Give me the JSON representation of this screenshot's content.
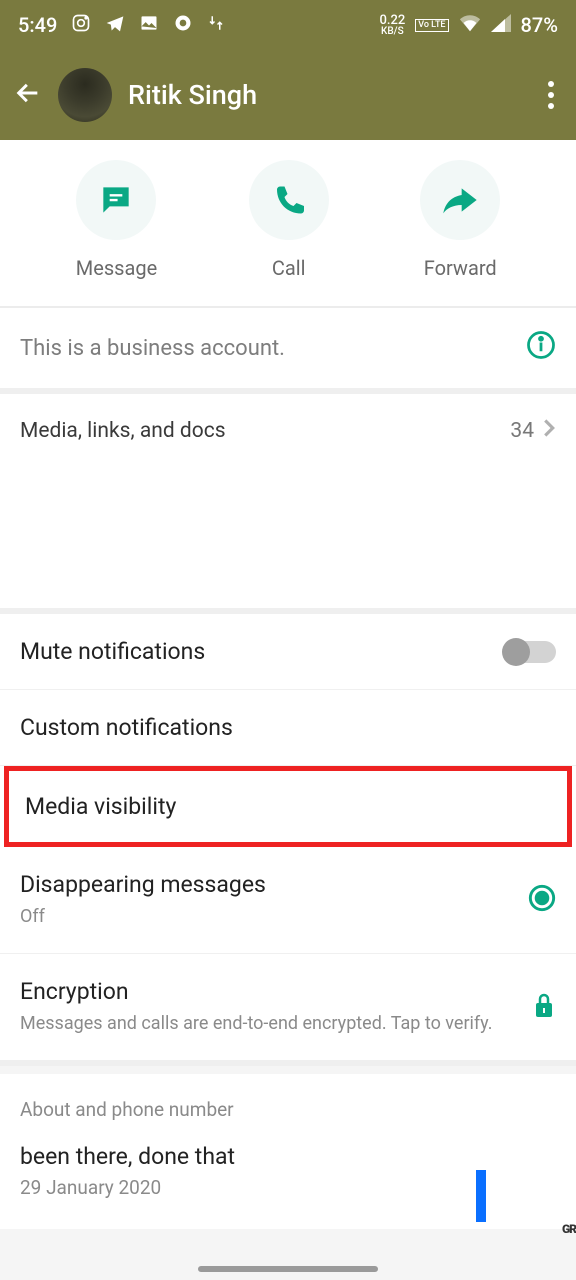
{
  "status": {
    "time": "5:49",
    "network_speed": "0.22",
    "network_unit": "KB/S",
    "lte_label": "Vo LTE",
    "battery": "87%"
  },
  "header": {
    "contact_name": "Ritik Singh"
  },
  "actions": {
    "message": "Message",
    "call": "Call",
    "forward": "Forward"
  },
  "business_banner": "This is a business account.",
  "media": {
    "label": "Media, links, and docs",
    "count": "34"
  },
  "settings": {
    "mute": "Mute notifications",
    "custom": "Custom notifications",
    "media_visibility": "Media visibility",
    "disappearing": "Disappearing messages",
    "disappearing_sub": "Off",
    "encryption": "Encryption",
    "encryption_sub": "Messages and calls are end-to-end encrypted. Tap to verify."
  },
  "about": {
    "header": "About and phone number",
    "status": "been there, done that",
    "date": "29 January 2020"
  }
}
